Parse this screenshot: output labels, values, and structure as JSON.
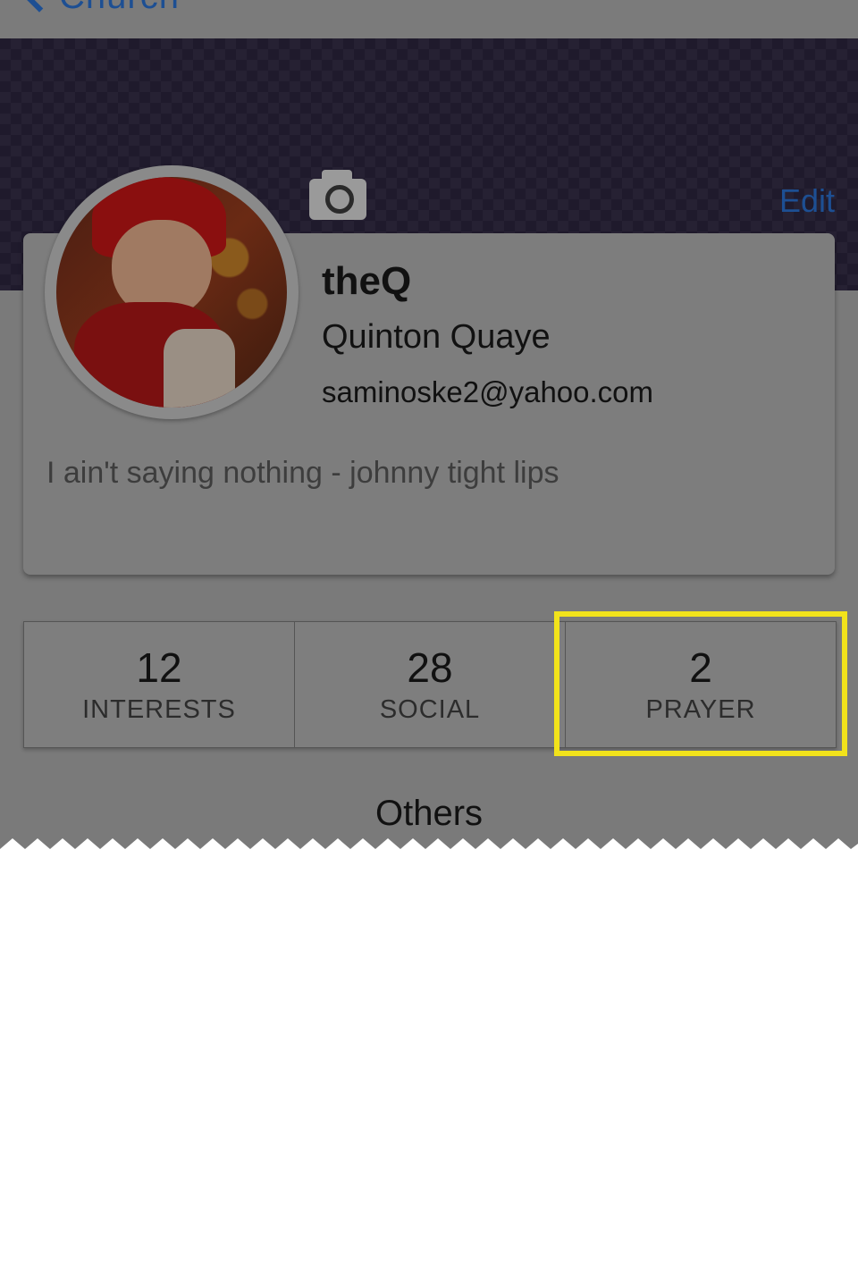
{
  "navbar": {
    "back_label": "Church"
  },
  "header": {
    "camera_icon": "camera-icon",
    "edit_label": "Edit",
    "accent_color": "#1d4f93"
  },
  "profile": {
    "username": "theQ",
    "full_name": "Quinton Quaye",
    "email": "saminoske2@yahoo.com",
    "status": "I ain't saying nothing - johnny tight lips"
  },
  "stats": [
    {
      "count": "12",
      "label": "INTERESTS"
    },
    {
      "count": "28",
      "label": "SOCIAL"
    },
    {
      "count": "2",
      "label": "PRAYER"
    }
  ],
  "highlight": {
    "target": "PRAYER",
    "color": "#f2e31b"
  },
  "section": {
    "others_label": "Others"
  }
}
